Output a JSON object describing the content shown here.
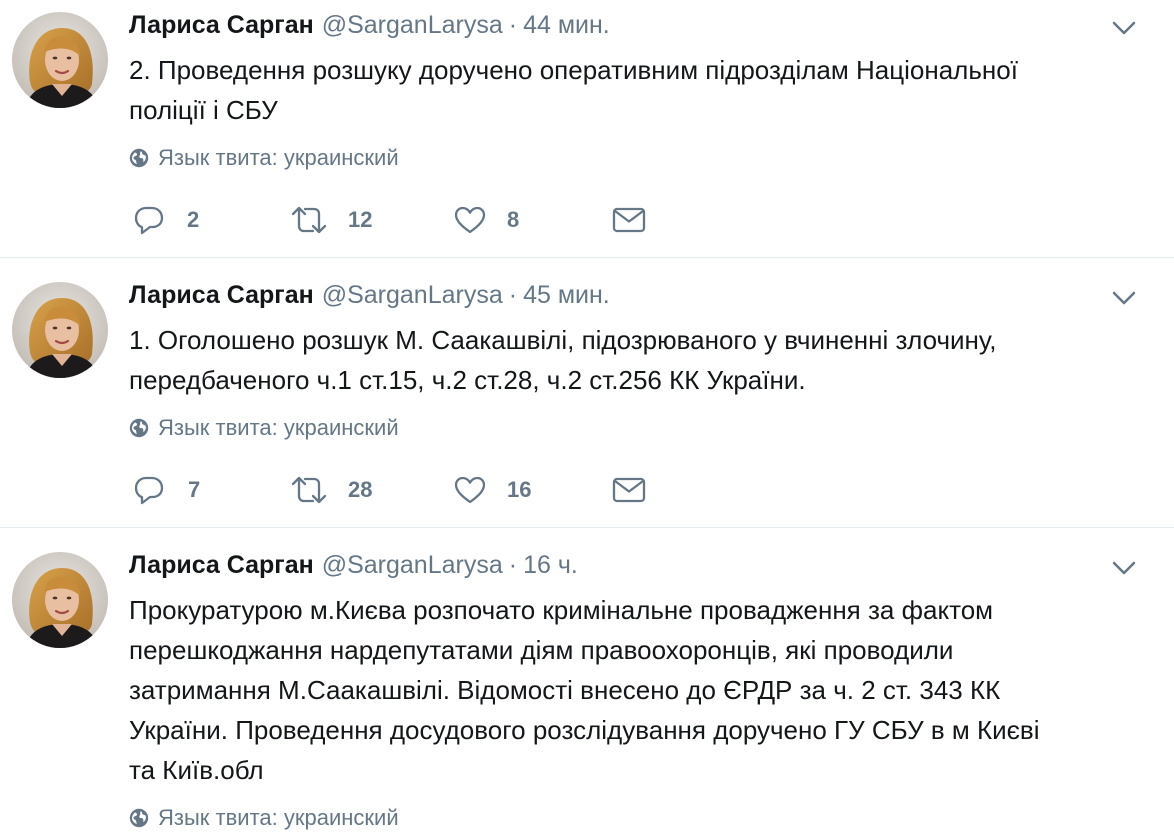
{
  "tweets": [
    {
      "name": "Лариса Сарган",
      "handle": "@SarganLarysa",
      "separator": "·",
      "time": "44 мин.",
      "lines": [
        "2. Проведення розшуку доручено оперативним підрозділам Національної",
        "поліції  і СБУ"
      ],
      "lang": "Язык твита: украинский",
      "replies": "2",
      "retweets": "12",
      "likes": "8"
    },
    {
      "name": "Лариса Сарган",
      "handle": "@SarganLarysa",
      "separator": "·",
      "time": "45 мин.",
      "lines": [
        "1. Оголошено розшук М. Саакашвілі, підозрюваного у вчиненні злочину,",
        "передбаченого ч.1 ст.15, ч.2 ст.28, ч.2 ст.256 КК України."
      ],
      "lang": "Язык твита: украинский",
      "replies": "7",
      "retweets": "28",
      "likes": "16"
    },
    {
      "name": "Лариса Сарган",
      "handle": "@SarganLarysa",
      "separator": "·",
      "time": "16 ч.",
      "lines": [
        "Прокуратурою м.Києва розпочато кримінальне провадження за фактом",
        "перешкоджання нардепутатами діям правоохоронців, які проводили",
        "затримання М.Саакашвілі. Відомості внесено до ЄРДР за ч. 2 ст. 343 КК",
        "України. Проведення досудового розслідування доручено ГУ СБУ в м Києві",
        "та Київ.обл"
      ],
      "lang": "Язык твита: украинский"
    }
  ],
  "icons": {
    "reply": "speech-bubble-icon",
    "retweet": "retweet-arrows-icon",
    "like": "heart-icon",
    "dm": "envelope-icon",
    "menu": "chevron-down-icon",
    "lang": "globe-icon"
  },
  "colors": {
    "text": "#14171a",
    "secondary": "#657786",
    "divider": "#e6ecf0"
  }
}
